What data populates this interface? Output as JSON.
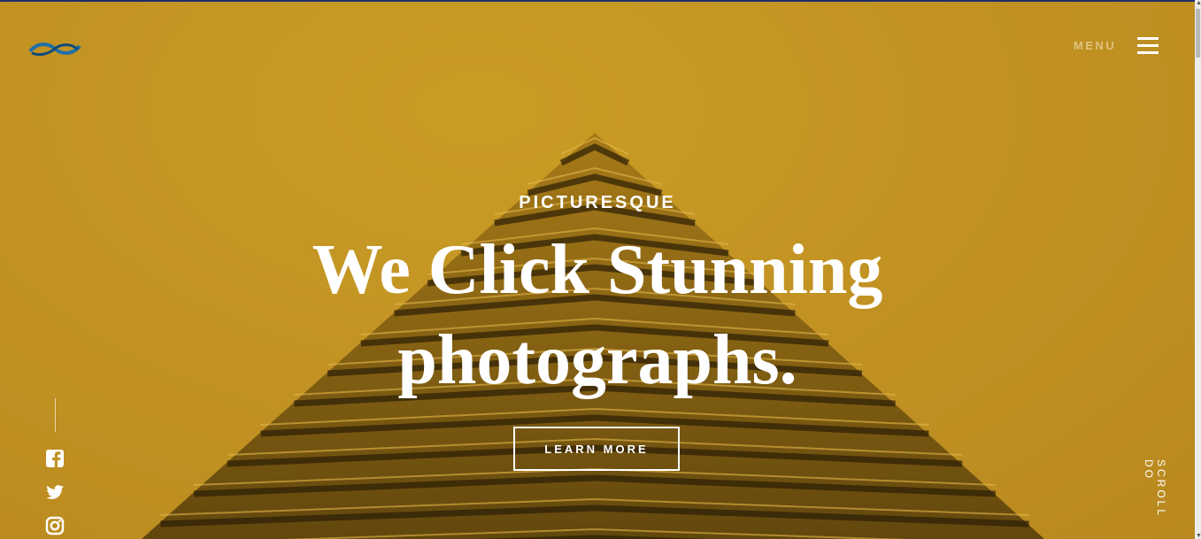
{
  "header": {
    "logo_icon": "infinity-wave-logo-icon",
    "menu_label": "MENU",
    "menu_icon": "hamburger-icon"
  },
  "hero": {
    "eyebrow": "PICTURESQUE",
    "headline_line1": "We Click Stunning",
    "headline_line2": "photographs.",
    "cta_label": "LEARN MORE",
    "background_icon": "pyramid-building-photo"
  },
  "social": {
    "icons": [
      "facebook-icon",
      "twitter-icon",
      "instagram-icon"
    ]
  },
  "scroll_label": "SCROLL DO",
  "colors": {
    "overlay": "#c29323",
    "text": "#ffffff",
    "menu_text": "#e0c280",
    "logo_blue": "#1f6fa8"
  }
}
